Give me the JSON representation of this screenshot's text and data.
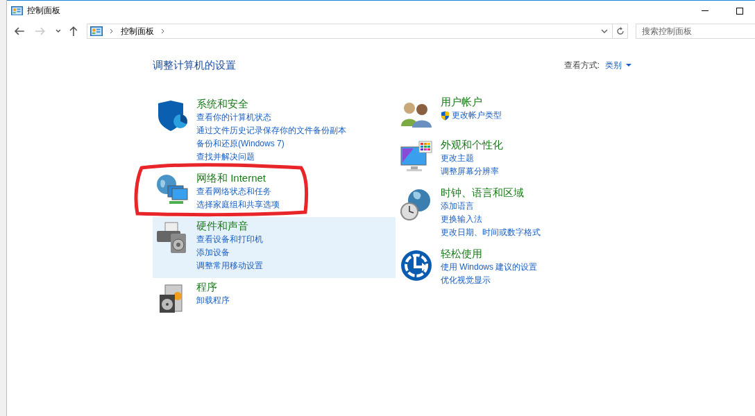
{
  "window": {
    "title": "控制面板"
  },
  "nav_buttons": [
    {
      "kind": "back",
      "disabled": false
    },
    {
      "kind": "forward",
      "disabled": true
    },
    {
      "kind": "history",
      "disabled": false
    },
    {
      "kind": "up",
      "disabled": false
    }
  ],
  "address": {
    "breadcrumb": [
      "控制面板"
    ]
  },
  "search": {
    "placeholder": "搜索控制面板"
  },
  "heading": "调整计算机的设置",
  "view_by": {
    "label": "查看方式:",
    "value": "类别"
  },
  "left_column": [
    {
      "kind": "security",
      "title": "系统和安全",
      "highlighted": false,
      "circled": false,
      "links": [
        {
          "text": "查看你的计算机状态",
          "kind": "plain"
        },
        {
          "text": "通过文件历史记录保存你的文件备份副本",
          "kind": "plain"
        },
        {
          "text": "备份和还原(Windows 7)",
          "kind": "plain"
        },
        {
          "text": "查找并解决问题",
          "kind": "plain"
        }
      ]
    },
    {
      "kind": "network",
      "title": "网络和 Internet",
      "highlighted": false,
      "circled": true,
      "links": [
        {
          "text": "查看网络状态和任务",
          "kind": "plain"
        },
        {
          "text": "选择家庭组和共享选项",
          "kind": "plain"
        }
      ]
    },
    {
      "kind": "hardware",
      "title": "硬件和声音",
      "highlighted": true,
      "circled": false,
      "links": [
        {
          "text": "查看设备和打印机",
          "kind": "plain"
        },
        {
          "text": "添加设备",
          "kind": "plain"
        },
        {
          "text": "调整常用移动设置",
          "kind": "plain"
        }
      ]
    },
    {
      "kind": "programs",
      "title": "程序",
      "highlighted": false,
      "circled": false,
      "links": [
        {
          "text": "卸载程序",
          "kind": "plain"
        }
      ]
    }
  ],
  "right_column": [
    {
      "kind": "users",
      "title": "用户帐户",
      "highlighted": false,
      "circled": false,
      "links": [
        {
          "text": "更改帐户类型",
          "kind": "admin"
        }
      ]
    },
    {
      "kind": "appearance",
      "title": "外观和个性化",
      "highlighted": false,
      "circled": false,
      "links": [
        {
          "text": "更改主题",
          "kind": "plain"
        },
        {
          "text": "调整屏幕分辨率",
          "kind": "plain"
        }
      ]
    },
    {
      "kind": "clock",
      "title": "时钟、语言和区域",
      "highlighted": false,
      "circled": false,
      "links": [
        {
          "text": "添加语言",
          "kind": "plain"
        },
        {
          "text": "更换输入法",
          "kind": "plain"
        },
        {
          "text": "更改日期、时间或数字格式",
          "kind": "plain"
        }
      ]
    },
    {
      "kind": "access",
      "title": "轻松使用",
      "highlighted": false,
      "circled": false,
      "links": [
        {
          "text": "使用 Windows 建议的设置",
          "kind": "plain"
        },
        {
          "text": "优化视觉显示",
          "kind": "plain"
        }
      ]
    }
  ]
}
